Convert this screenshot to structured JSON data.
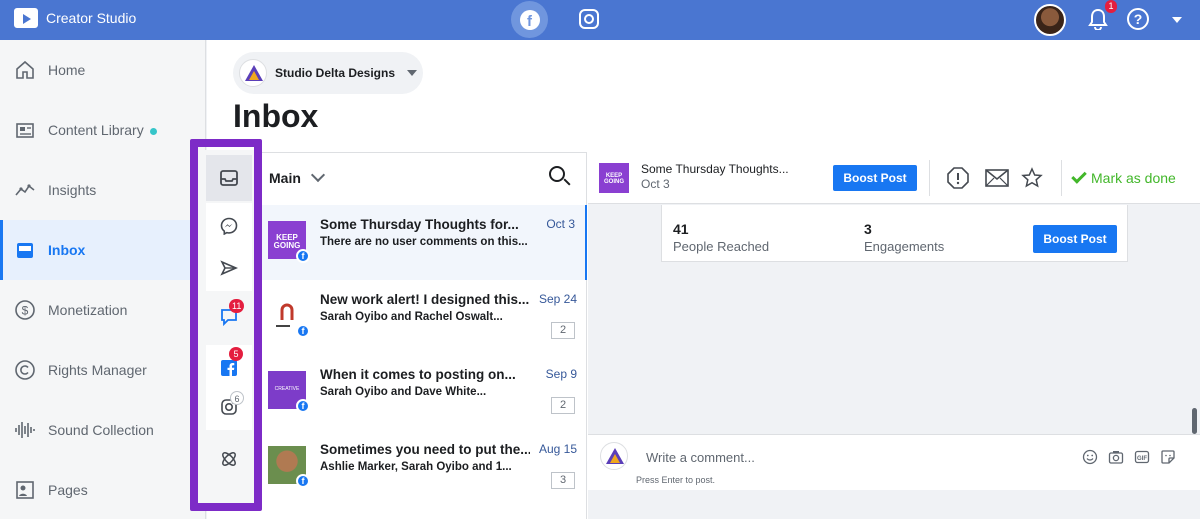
{
  "topbar": {
    "app_title": "Creator Studio",
    "notification_count": "1",
    "help_glyph": "?"
  },
  "sidebar": {
    "items": [
      {
        "label": "Home",
        "icon": "home-icon"
      },
      {
        "label": "Content Library",
        "icon": "content-library-icon"
      },
      {
        "label": "Insights",
        "icon": "insights-icon"
      },
      {
        "label": "Inbox",
        "icon": "inbox-icon"
      },
      {
        "label": "Monetization",
        "icon": "dollar-icon"
      },
      {
        "label": "Rights Manager",
        "icon": "copyright-icon"
      },
      {
        "label": "Sound Collection",
        "icon": "sound-wave-icon"
      },
      {
        "label": "Pages",
        "icon": "pages-icon"
      }
    ]
  },
  "page_switcher": {
    "name": "Studio Delta Designs"
  },
  "page_title": "Inbox",
  "rail": {
    "comments_badge": "11",
    "facebook_badge": "5",
    "instagram_badge": "6"
  },
  "list": {
    "header": "Main",
    "rows": [
      {
        "title": "Some Thursday Thoughts for...",
        "sub": "There are no user comments on this...",
        "date": "Oct 3",
        "count": ""
      },
      {
        "title": "New work alert! I designed this...",
        "sub": "Sarah Oyibo and Rachel Oswalt...",
        "date": "Sep 24",
        "count": "2"
      },
      {
        "title": "When it comes to posting on...",
        "sub": "Sarah Oyibo and Dave White...",
        "date": "Sep 9",
        "count": "2"
      },
      {
        "title": "Sometimes you need to put the...",
        "sub": "Ashlie Marker, Sarah Oyibo and 1...",
        "date": "Aug 15",
        "count": "3"
      }
    ],
    "thumb_text": "KEEP GOING",
    "thumb_text_2": "CREATIVE"
  },
  "detail": {
    "title": "Some Thursday Thoughts...",
    "date": "Oct 3",
    "boost_label": "Boost Post",
    "mark_done_label": "Mark as done",
    "stats": {
      "reached_value": "41",
      "reached_label": "People Reached",
      "engagements_value": "3",
      "engagements_label": "Engagements"
    },
    "composer_placeholder": "Write a comment...",
    "composer_hint": "Press Enter to post."
  },
  "colors": {
    "topbar": "#4a76d1",
    "accent": "#1877f2",
    "highlight_frame": "#7d2bc7",
    "done_green": "#42b72a",
    "badge_red": "#e41e3f"
  }
}
